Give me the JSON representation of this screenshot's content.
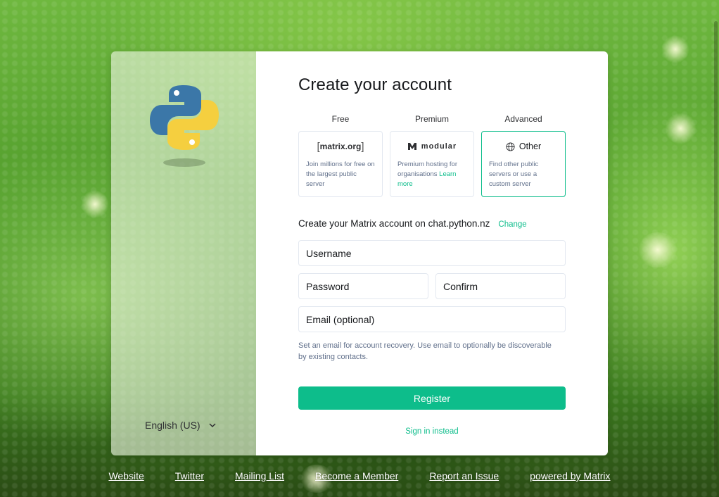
{
  "background": {
    "theme": "green-snake-scales"
  },
  "sidebar": {
    "logo_icon": "python-logo",
    "language": {
      "label": "English (US)",
      "icon": "chevron-down-icon"
    }
  },
  "form": {
    "title": "Create your account",
    "plans": [
      {
        "label": "Free",
        "logo_text": "matrix.org",
        "description": "Join millions for free on the largest public server",
        "selected": false
      },
      {
        "label": "Premium",
        "logo_text": "modular",
        "description": "Premium hosting for organisations",
        "link": "Learn more",
        "selected": false
      },
      {
        "label": "Advanced",
        "logo_text": "Other",
        "logo_icon": "globe-icon",
        "description": "Find other public servers or use a custom server",
        "selected": true
      }
    ],
    "server_text": "Create your Matrix account on chat.python.nz",
    "change_label": "Change",
    "username_placeholder": "Username",
    "password_placeholder": "Password",
    "confirm_placeholder": "Confirm",
    "email_placeholder": "Email (optional)",
    "email_hint": "Set an email for account recovery. Use email to optionally be discoverable by existing contacts.",
    "register_label": "Register",
    "signin_label": "Sign in instead"
  },
  "footer": {
    "links": [
      "Website",
      "Twitter",
      "Mailing List",
      "Become a Member",
      "Report an Issue",
      "powered by Matrix"
    ]
  },
  "colors": {
    "accent": "#0dbd8b",
    "text": "#17191c",
    "muted": "#61708b",
    "border": "#e3e8f0"
  }
}
